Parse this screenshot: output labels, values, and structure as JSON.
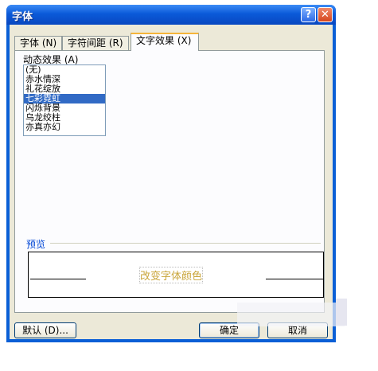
{
  "window": {
    "title": "字体",
    "help_label": "?",
    "close_label": "✕"
  },
  "tabs": [
    {
      "label": "字体 (N)"
    },
    {
      "label": "字符间距 (R)"
    },
    {
      "label": "文字效果 (X)"
    }
  ],
  "effects": {
    "label": "动态效果 (A)",
    "items": [
      "(无)",
      "赤水情深",
      "礼花绽放",
      "七彩霓虹",
      "闪烁背景",
      "乌龙绞柱",
      "亦真亦幻"
    ],
    "selected_index": 3
  },
  "preview": {
    "label": "预览",
    "text": "改变字体颜色"
  },
  "buttons": {
    "default": "默认 (D)...",
    "ok": "确定",
    "cancel": "取消"
  }
}
